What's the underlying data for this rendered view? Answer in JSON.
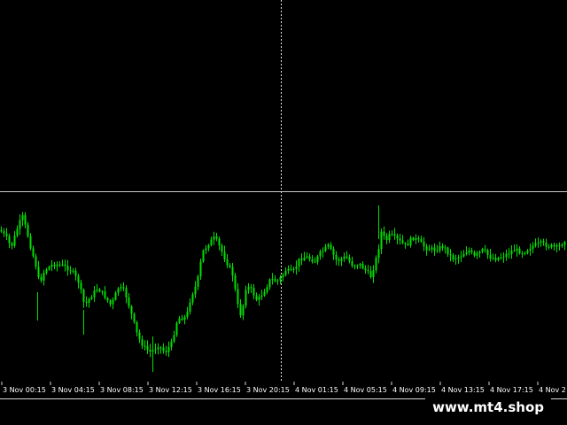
{
  "colors": {
    "background": "#000000",
    "candle": "#00e000",
    "grid": "#c8c8c8",
    "crosshair": "#e0e0e0",
    "text": "#ffffff"
  },
  "watermark": "www.mt4.shop",
  "chart_data": {
    "type": "line",
    "title": "",
    "xlabel": "",
    "ylabel": "",
    "x": [
      "3 Nov 00:15",
      "3 Nov 04:15",
      "3 Nov 08:15",
      "3 Nov 12:15",
      "3 Nov 16:15",
      "3 Nov 20:15",
      "4 Nov 01:15",
      "4 Nov 05:15",
      "4 Nov 09:15",
      "4 Nov 13:15",
      "4 Nov 17:15",
      "4 Nov 2"
    ],
    "series": [
      {
        "values": [
          265,
          300,
          340,
          395,
          270,
          320,
          290,
          275,
          275,
          290,
          285,
          270
        ]
      }
    ],
    "grid": false,
    "legend": "none"
  }
}
